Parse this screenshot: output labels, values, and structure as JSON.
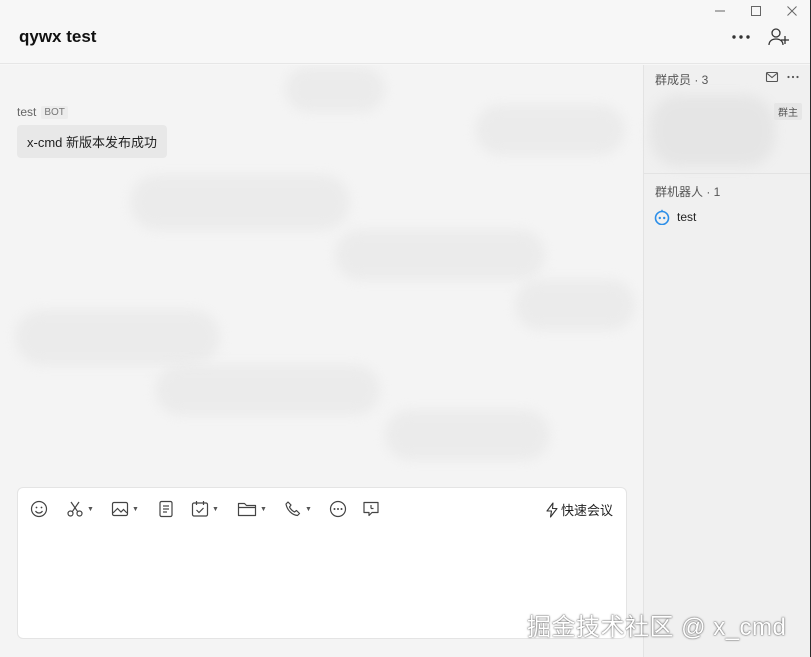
{
  "window": {
    "title": "qywx test",
    "controls": {
      "minimize_icon": "minimize-icon",
      "maximize_icon": "maximize-icon",
      "close_icon": "close-icon"
    }
  },
  "header": {
    "more_icon": "more-horizontal-icon",
    "add_member_icon": "add-user-icon"
  },
  "messages": [
    {
      "sender": "test",
      "tag": "BOT",
      "text": "x-cmd 新版本发布成功"
    }
  ],
  "composer": {
    "tools": [
      "emoji-icon",
      "screenshot-icon",
      "image-icon",
      "document-icon",
      "todo-icon",
      "folder-icon",
      "phone-icon",
      "more-circle-icon",
      "reply-icon"
    ],
    "quick_meeting_label": "快速会议"
  },
  "sidebar": {
    "members_header": "群成员 · 3",
    "owner_tag": "群主",
    "bots_header": "群机器人 · 1",
    "bots": [
      {
        "name": "test"
      }
    ]
  },
  "watermark": "掘金技术社区 @ x_cmd",
  "colors": {
    "bot_icon": "#2b8ee8",
    "background": "#f4f4f4",
    "composer": "#ffffff"
  }
}
